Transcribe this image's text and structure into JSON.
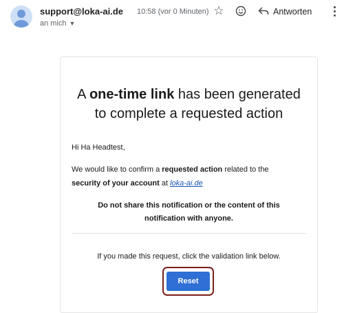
{
  "header": {
    "sender": "support@loka-ai.de",
    "recipient": "an mich",
    "time": "10:58 (vor 0 Minuten)",
    "reply_label": "Antworten",
    "icons": [
      "avatar",
      "star-icon",
      "emoji-icon",
      "reply-icon",
      "more-icon"
    ]
  },
  "email": {
    "headline_pre": "A ",
    "headline_bold": "one-time link",
    "headline_post": " has been generated",
    "headline_line2": "to complete a requested action",
    "greeting": "Hi Ha Headtest,",
    "para_1": "We would like to confirm a ",
    "para_bold_1": "requested action",
    "para_2": " related to the",
    "para_bold_2": "security of your account",
    "para_3": " at ",
    "link_text": "loka-ai.de",
    "warning_line1": "Do not share this notification or the content of this",
    "warning_line2": "notification with anyone.",
    "instruction": "If you made this request, click the validation link below.",
    "button_label": "Reset"
  },
  "colors": {
    "button": "#2f6fd6",
    "button_outline": "#7a1d1d",
    "link": "#1a56b4"
  }
}
